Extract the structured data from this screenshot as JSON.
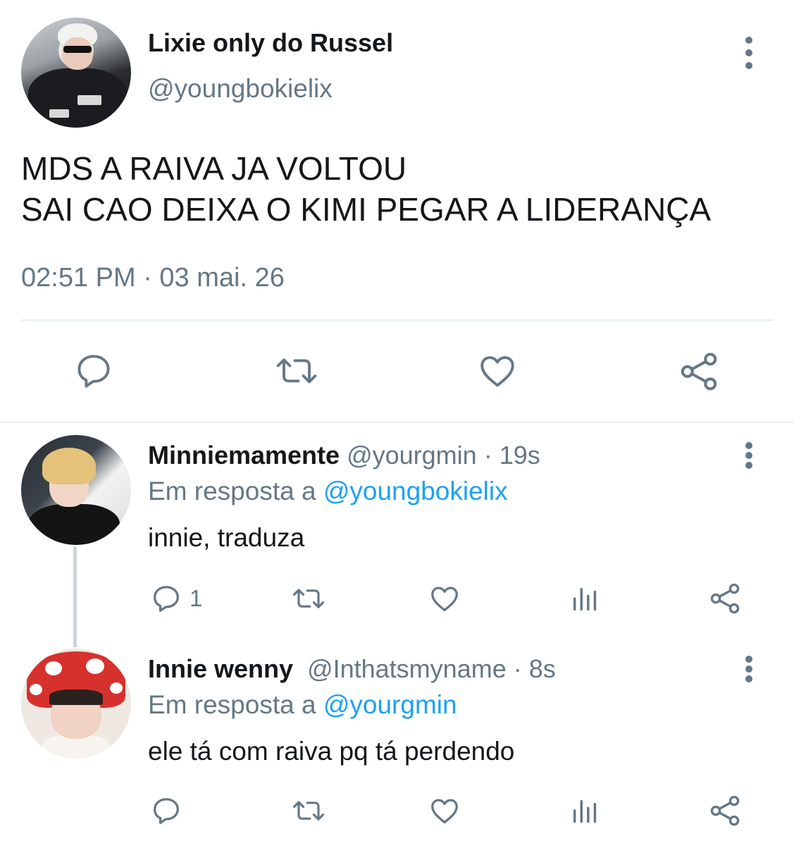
{
  "main_tweet": {
    "display_name": "Lixie only do Russel",
    "handle": "@youngbokielix",
    "text": "MDS A RAIVA JA VOLTOU\nSAI CAO DEIXA O KIMI PEGAR A LIDERANÇA",
    "timestamp": "02:51 PM · 03 mai. 26",
    "actions": [
      "reply-icon",
      "retweet-icon",
      "like-icon",
      "share-icon"
    ]
  },
  "replies": [
    {
      "display_name": "Minniemamente",
      "handle": "@yourgmin",
      "time": "· 19s",
      "reply_prefix": "Em resposta a ",
      "reply_to": "@youngbokielix",
      "text": "innie, traduza",
      "reply_count": "1",
      "actions": [
        "reply-icon",
        "retweet-icon",
        "like-icon",
        "analytics-icon",
        "share-icon"
      ]
    },
    {
      "display_name": "Innie wenny",
      "handle": "@Inthatsmyname",
      "time": "· 8s",
      "reply_prefix": "Em resposta a ",
      "reply_to": "@yourgmin",
      "text": "ele tá com raiva pq tá perdendo",
      "reply_count": "",
      "actions": [
        "reply-icon",
        "retweet-icon",
        "like-icon",
        "analytics-icon",
        "share-icon"
      ]
    }
  ],
  "colors": {
    "text_primary": "#14171a",
    "text_secondary": "#657786",
    "link": "#1da1f2",
    "divider": "#e6ecf0",
    "thread_line": "#ccd6dd"
  }
}
